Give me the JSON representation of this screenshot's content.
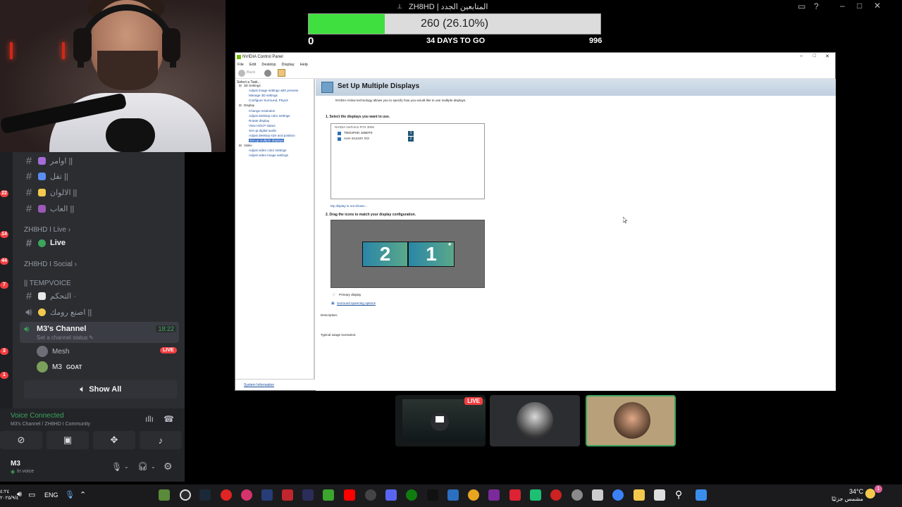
{
  "stream": {
    "title": "ZH8HD | المتابعين الجدد",
    "goal_text": "260 (26.10%)",
    "goal_fraction": 0.261,
    "goal_min": "0",
    "goal_max": "996",
    "goal_deadline": "34 DAYS TO GO"
  },
  "discord": {
    "channels": [
      {
        "name": "اوامر ||",
        "emoji_color": "#a46cd8"
      },
      {
        "name": "تقل ||",
        "emoji_color": "#5b8def"
      },
      {
        "name": "الالوان ||",
        "emoji_color": "#f2c94c"
      },
      {
        "name": "العاب ||",
        "emoji_color": "#9b59b6"
      }
    ],
    "category_live": "ZH8HD I Live",
    "live_channel": "Live",
    "category_social": "ZH8HD I Social",
    "category_tempvoice": "|| TEMPVOICE",
    "tempvoice_channels": [
      {
        "name": "التحكم ·"
      },
      {
        "name": "اصنع رومك ||"
      }
    ],
    "voice_channel": {
      "name": "M3's Channel",
      "time": "18:22",
      "status_hint": "Set a channel status"
    },
    "voice_users": [
      {
        "name": "Mesh",
        "badge": "LIVE"
      },
      {
        "name": "M3",
        "tag": "GOAT"
      }
    ],
    "show_all": "Show All",
    "guild_badges": [
      "22",
      "14",
      "44",
      "7",
      "3",
      "1"
    ],
    "voice_connected": "Voice Connected",
    "voice_connected_path": "M3's Channel / ZH8HD I Community",
    "user": {
      "name": "M3",
      "status": "In voice"
    }
  },
  "nvidia": {
    "window_title": "NVIDIA Control Panel",
    "menu": [
      "File",
      "Edit",
      "Desktop",
      "Display",
      "Help"
    ],
    "back_label": "Back",
    "task_label": "Select a Task...",
    "tree": [
      {
        "label": "3D Settings",
        "kind": "h"
      },
      {
        "label": "Adjust image settings with preview",
        "kind": "l"
      },
      {
        "label": "Manage 3D settings",
        "kind": "l"
      },
      {
        "label": "Configure Surround, PhysX",
        "kind": "l"
      },
      {
        "label": "Display",
        "kind": "h"
      },
      {
        "label": "Change resolution",
        "kind": "l"
      },
      {
        "label": "Adjust desktop color settings",
        "kind": "l"
      },
      {
        "label": "Rotate display",
        "kind": "l"
      },
      {
        "label": "View HDCP status",
        "kind": "l"
      },
      {
        "label": "Set up digital audio",
        "kind": "l"
      },
      {
        "label": "Adjust desktop size and position",
        "kind": "l"
      },
      {
        "label": "Set up multiple displays",
        "kind": "sel"
      },
      {
        "label": "Video",
        "kind": "h"
      },
      {
        "label": "Adjust video color settings",
        "kind": "l"
      },
      {
        "label": "Adjust video image settings",
        "kind": "l"
      }
    ],
    "system_info": "System Information",
    "page_title": "Set Up Multiple Displays",
    "intro": "NVIDIA nView technology allows you to specify how you would like to use multiple displays.",
    "step1": "1. Select the displays you want to use.",
    "gpu": "NVIDIA GeForce RTX 3060",
    "displays": [
      {
        "name": "TMO4PHD 165EPS",
        "num": "1",
        "checked": true
      },
      {
        "name": "Acer SA243Y GO",
        "num": "2",
        "checked": true
      }
    ],
    "not_shown": "My display is not shown...",
    "step2": "2. Drag the icons to match your display configuration.",
    "monitor_left": "2",
    "monitor_right": "1",
    "primary_label": "Primary display",
    "surround_link": "Surround spanning options",
    "description_label": "Description:",
    "typical_label": "Typical usage scenarios:"
  },
  "tiles": {
    "live_badge": "LIVE"
  },
  "taskbar": {
    "time_left": "٤:٢٤",
    "date_left": "٢٠٢٥/٩/٤",
    "lang": "ENG",
    "temp": "34°C",
    "weather": "مشمس جزئيًا",
    "notif_count": "1"
  }
}
